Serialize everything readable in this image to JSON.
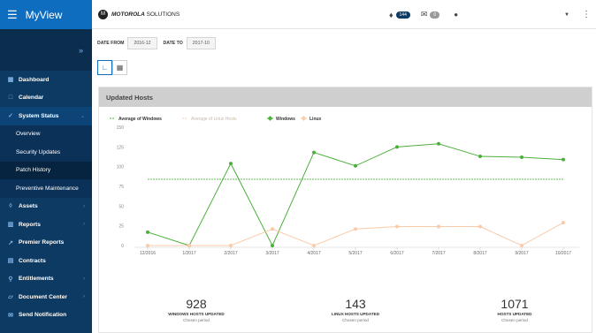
{
  "sidebar": {
    "brand": "MyView",
    "items": [
      {
        "label": "Dashboard",
        "icon": "grid-icon"
      },
      {
        "label": "Calendar",
        "icon": "calendar-icon"
      },
      {
        "label": "System Status",
        "icon": "check-circle-icon"
      },
      {
        "label": "Overview"
      },
      {
        "label": "Security Updates"
      },
      {
        "label": "Patch History"
      },
      {
        "label": "Preventive Maintenance"
      },
      {
        "label": "Assets",
        "icon": "sitemap-icon"
      },
      {
        "label": "Reports",
        "icon": "bar-chart-icon"
      },
      {
        "label": "Premier Reports",
        "icon": "chart-up-icon"
      },
      {
        "label": "Contracts",
        "icon": "contract-icon"
      },
      {
        "label": "Entitlements",
        "icon": "pin-icon"
      },
      {
        "label": "Document Center",
        "icon": "folder-icon"
      },
      {
        "label": "Send Notification",
        "icon": "mail-icon"
      }
    ]
  },
  "topbar": {
    "logo_bold": "MOTOROLA",
    "logo_rest": " SOLUTIONS",
    "notifications_count": "144",
    "messages_count": "0"
  },
  "filters": {
    "date_from_label": "DATE FROM",
    "date_from_value": "2016-12",
    "date_to_label": "DATE TO",
    "date_to_value": "2017-10"
  },
  "panel": {
    "title": "Updated Hosts"
  },
  "stats": [
    {
      "value": "928",
      "label": "WINDOWS HOSTS UPDATED",
      "period": "Chosen period"
    },
    {
      "value": "143",
      "label": "LINUX HOSTS UPDATED",
      "period": "Chosen period"
    },
    {
      "value": "1071",
      "label": "HOSTS UPDATED",
      "period": "Chosen period"
    }
  ],
  "colors": {
    "windows": "#4caf3c",
    "linux": "#f9cba8",
    "avg_windows": "#4caf3c",
    "avg_linux": "#f9cba8",
    "sidebar": "#0c3a63",
    "brand": "#0f6dbf"
  },
  "chart_data": {
    "type": "line",
    "categories": [
      "12/2016",
      "1/2017",
      "2/2017",
      "3/2017",
      "4/2017",
      "5/2017",
      "6/2017",
      "7/2017",
      "8/2017",
      "9/2017",
      "10/2017"
    ],
    "series": [
      {
        "name": "Average of Windows",
        "values": [
          84,
          84,
          84,
          84,
          84,
          84,
          84,
          84,
          84,
          84,
          84
        ],
        "style": "dashed"
      },
      {
        "name": "Average of Linux Hosts",
        "values": [
          13,
          13,
          13,
          13,
          13,
          13,
          13,
          13,
          13,
          13,
          13
        ],
        "style": "dashed"
      },
      {
        "name": "Windows",
        "values": [
          17,
          0,
          104,
          0,
          118,
          101,
          125,
          129,
          113,
          112,
          109
        ],
        "style": "solid"
      },
      {
        "name": "Linux",
        "values": [
          0,
          0,
          0,
          21,
          0,
          21,
          24,
          24,
          24,
          0,
          29
        ],
        "style": "solid"
      }
    ],
    "ylim": [
      0,
      150
    ],
    "yticks": [
      0,
      25,
      50,
      75,
      100,
      125,
      150
    ],
    "grid": false,
    "legend_position": "top-left"
  }
}
